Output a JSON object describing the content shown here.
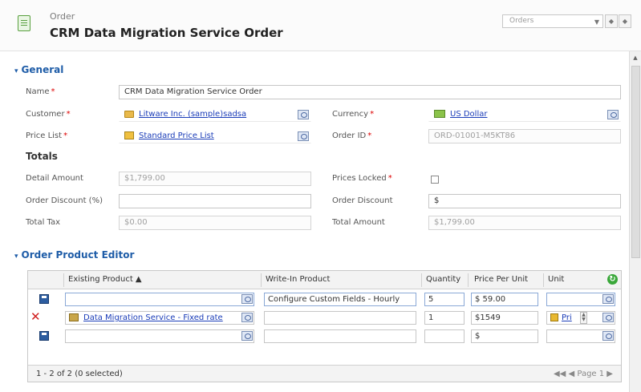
{
  "header": {
    "entity_type": "Order",
    "title": "CRM Data Migration Service Order",
    "nav_select_value": "Orders",
    "nav_prev": "◆",
    "nav_next": "◆"
  },
  "sections": {
    "general": "General",
    "totals": "Totals",
    "product_editor": "Order Product Editor"
  },
  "fields": {
    "name": {
      "label": "Name",
      "value": "CRM Data Migration Service Order",
      "required": "*"
    },
    "customer": {
      "label": "Customer",
      "value": "Litware Inc. (sample)sadsa",
      "required": "*"
    },
    "currency": {
      "label": "Currency",
      "value": "US Dollar",
      "required": "*"
    },
    "price_list": {
      "label": "Price List",
      "value": "Standard Price List",
      "required": "*"
    },
    "order_id": {
      "label": "Order ID",
      "value": "ORD-01001-M5KT86",
      "required": "*"
    },
    "detail_amount": {
      "label": "Detail Amount",
      "value": "$1,799.00"
    },
    "prices_locked": {
      "label": "Prices Locked",
      "required": "*"
    },
    "order_discount_pct": {
      "label": "Order Discount (%)",
      "value": ""
    },
    "order_discount": {
      "label": "Order Discount",
      "value": "$"
    },
    "total_tax": {
      "label": "Total Tax",
      "value": "$0.00"
    },
    "total_amount": {
      "label": "Total Amount",
      "value": "$1,799.00"
    }
  },
  "grid": {
    "columns": [
      "Existing Product ▲",
      "Write-In Product",
      "Quantity",
      "Price Per Unit",
      "Unit"
    ],
    "rows": [
      {
        "existing_product": "",
        "write_in": "Configure Custom Fields - Hourly",
        "quantity": "5",
        "price": "$ 59.00",
        "unit": ""
      },
      {
        "existing_product": "Data Migration Service - Fixed rate",
        "write_in": "",
        "quantity": "1",
        "price": "$1549",
        "unit": "Pri"
      },
      {
        "existing_product": "",
        "write_in": "",
        "quantity": "",
        "price": "$",
        "unit": ""
      }
    ],
    "footer_selection": "1 - 2 of 2 (0 selected)",
    "footer_pager": "◀◀  ◀  Page 1  ▶"
  },
  "icons": {
    "entity": "order-icon",
    "refresh": "refresh-icon",
    "save": "save-icon",
    "delete": "delete-icon",
    "lookup": "lookup-icon"
  },
  "colors": {
    "section_heading": "#1f5da8",
    "link": "#1a3cb8",
    "required": "#dd0000",
    "delete": "#d02020"
  }
}
